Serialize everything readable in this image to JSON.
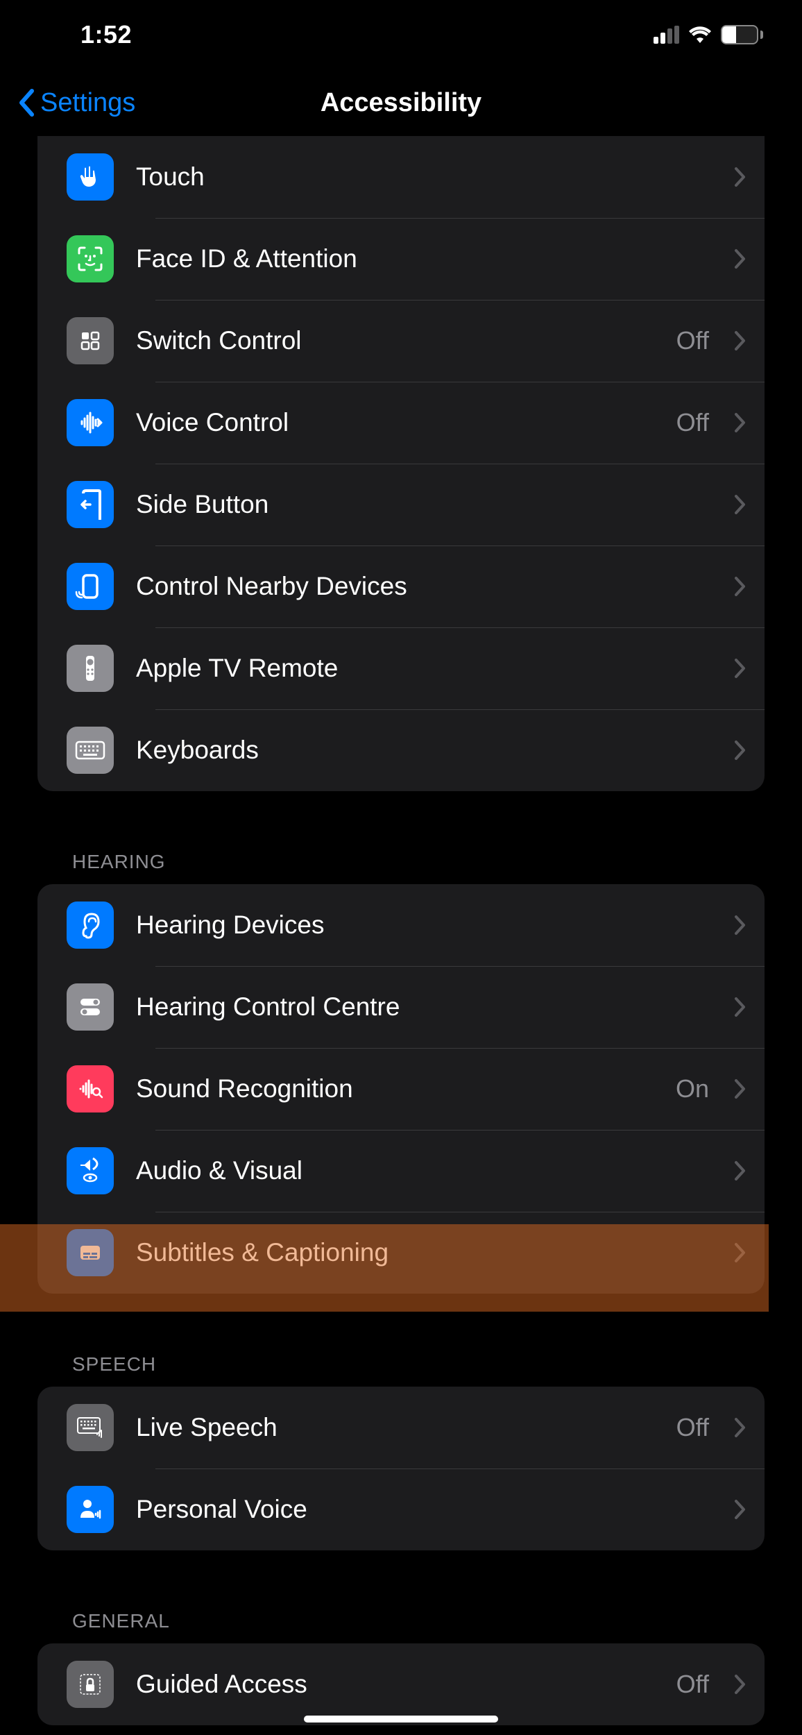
{
  "status": {
    "time": "1:52",
    "battery": "39"
  },
  "nav": {
    "back": "Settings",
    "title": "Accessibility"
  },
  "groups": [
    {
      "header": null,
      "items": [
        {
          "label": "Touch",
          "value": null
        },
        {
          "label": "Face ID & Attention",
          "value": null
        },
        {
          "label": "Switch Control",
          "value": "Off"
        },
        {
          "label": "Voice Control",
          "value": "Off"
        },
        {
          "label": "Side Button",
          "value": null
        },
        {
          "label": "Control Nearby Devices",
          "value": null
        },
        {
          "label": "Apple TV Remote",
          "value": null
        },
        {
          "label": "Keyboards",
          "value": null
        }
      ]
    },
    {
      "header": "HEARING",
      "items": [
        {
          "label": "Hearing Devices",
          "value": null
        },
        {
          "label": "Hearing Control Centre",
          "value": null
        },
        {
          "label": "Sound Recognition",
          "value": "On"
        },
        {
          "label": "Audio & Visual",
          "value": null
        },
        {
          "label": "Subtitles & Captioning",
          "value": null
        }
      ]
    },
    {
      "header": "SPEECH",
      "items": [
        {
          "label": "Live Speech",
          "value": "Off"
        },
        {
          "label": "Personal Voice",
          "value": null
        }
      ]
    },
    {
      "header": "GENERAL",
      "items": [
        {
          "label": "Guided Access",
          "value": "Off"
        }
      ]
    }
  ]
}
